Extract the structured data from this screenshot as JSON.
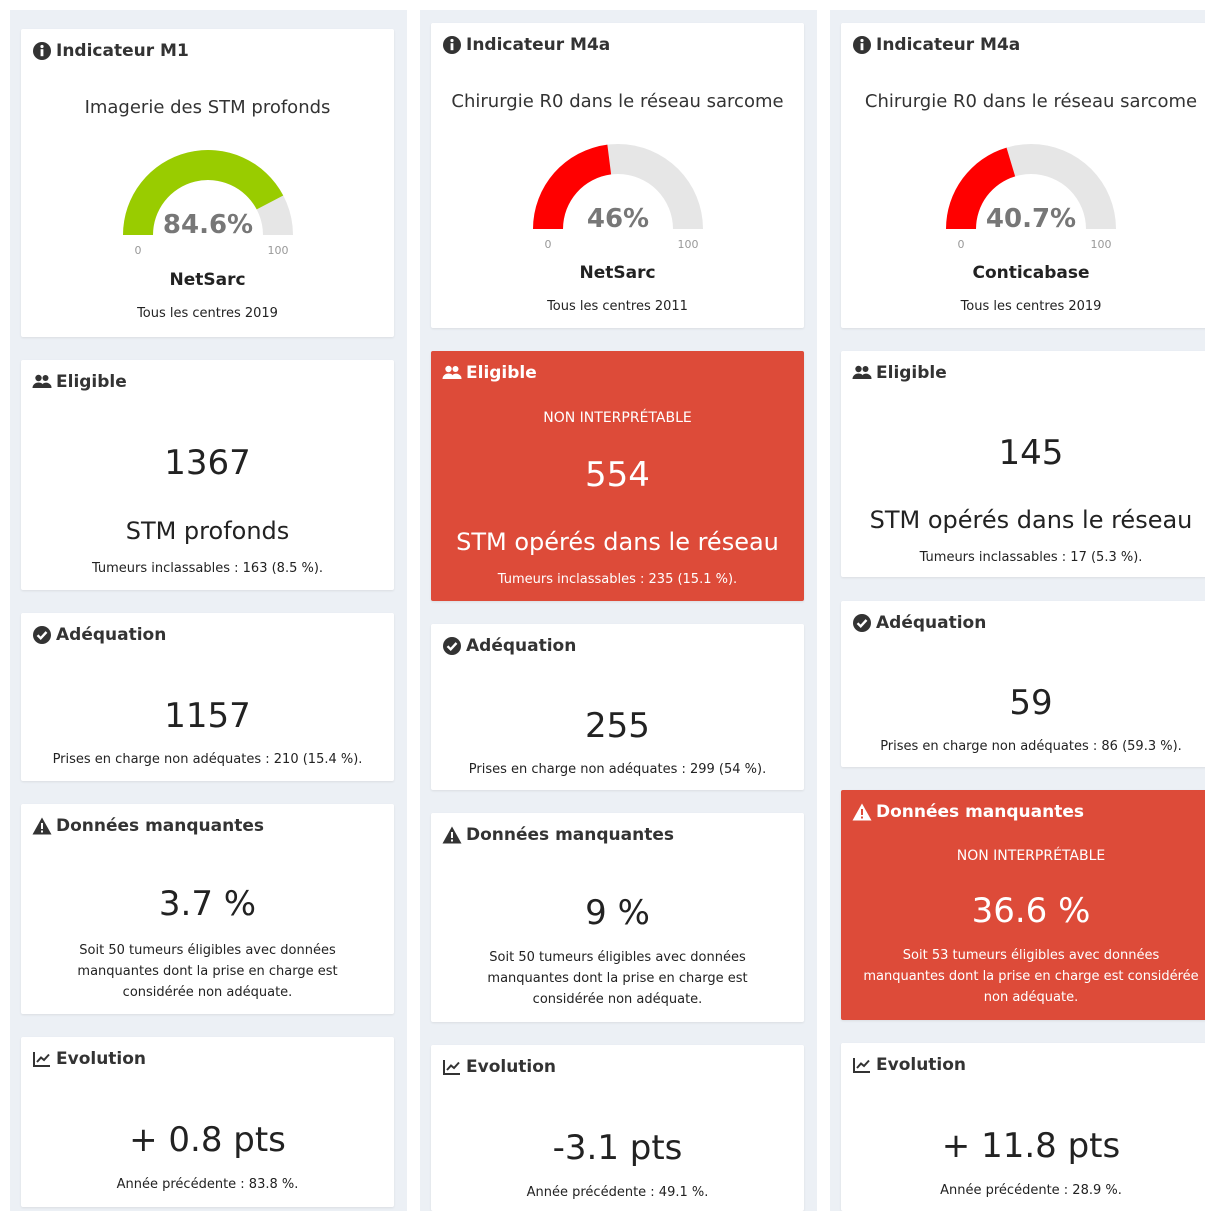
{
  "columns": [
    {
      "indicator": {
        "title": "Indicateur M1",
        "subtitle": "Imagerie des STM profonds",
        "gauge": {
          "value": 84.6,
          "display": "84.6%",
          "min_label": "0",
          "max_label": "100",
          "color": "#99cc00"
        },
        "source": "NetSarc",
        "scope": "Tous les centres 2019"
      },
      "eligible": {
        "title": "Eligible",
        "badge": "",
        "value": "1367",
        "label": "STM profonds",
        "note": "Tumeurs inclassables : 163 (8.5 %)."
      },
      "adequation": {
        "title": "Adéquation",
        "value": "1157",
        "note": "Prises en charge non adéquates : 210 (15.4 %)."
      },
      "missing": {
        "title": "Données manquantes",
        "badge": "",
        "value": "3.7 %",
        "note": "Soit 50 tumeurs éligibles avec données manquantes dont la prise en charge est considérée non adéquate."
      },
      "evolution": {
        "title": "Evolution",
        "value": "+ 0.8 pts",
        "note": "Année précédente : 83.8 %."
      }
    },
    {
      "indicator": {
        "title": "Indicateur M4a",
        "subtitle": "Chirurgie R0 dans le réseau sarcome",
        "gauge": {
          "value": 46,
          "display": "46%",
          "min_label": "0",
          "max_label": "100",
          "color": "#ff0000"
        },
        "source": "NetSarc",
        "scope": "Tous les centres 2011"
      },
      "eligible": {
        "title": "Eligible",
        "badge": "NON INTERPRÉTABLE",
        "value": "554",
        "label": "STM opérés dans le réseau",
        "note": "Tumeurs inclassables : 235 (15.1 %)."
      },
      "adequation": {
        "title": "Adéquation",
        "value": "255",
        "note": "Prises en charge non adéquates : 299 (54 %)."
      },
      "missing": {
        "title": "Données manquantes",
        "badge": "",
        "value": "9 %",
        "note": "Soit 50 tumeurs éligibles avec données manquantes dont la prise en charge est considérée non adéquate."
      },
      "evolution": {
        "title": "Evolution",
        "value": "-3.1 pts",
        "note": "Année précédente : 49.1 %."
      }
    },
    {
      "indicator": {
        "title": "Indicateur M4a",
        "subtitle": "Chirurgie R0 dans le réseau sarcome",
        "gauge": {
          "value": 40.7,
          "display": "40.7%",
          "min_label": "0",
          "max_label": "100",
          "color": "#ff0000"
        },
        "source": "Conticabase",
        "scope": "Tous les centres 2019"
      },
      "eligible": {
        "title": "Eligible",
        "badge": "",
        "value": "145",
        "label": "STM opérés dans le réseau",
        "note": "Tumeurs inclassables : 17 (5.3 %)."
      },
      "adequation": {
        "title": "Adéquation",
        "value": "59",
        "note": "Prises en charge non adéquates : 86 (59.3 %)."
      },
      "missing": {
        "title": "Données manquantes",
        "badge": "NON INTERPRÉTABLE",
        "value": "36.6 %",
        "note": "Soit 53 tumeurs éligibles avec données manquantes dont la prise en charge est considérée non adéquate."
      },
      "evolution": {
        "title": "Evolution",
        "value": "+ 11.8 pts",
        "note": "Année précédente : 28.9 %."
      }
    }
  ],
  "colors": {
    "alert_red": "#dd4b39",
    "panel_bg": "#ecf0f5",
    "gauge_track": "#e6e6e6"
  }
}
